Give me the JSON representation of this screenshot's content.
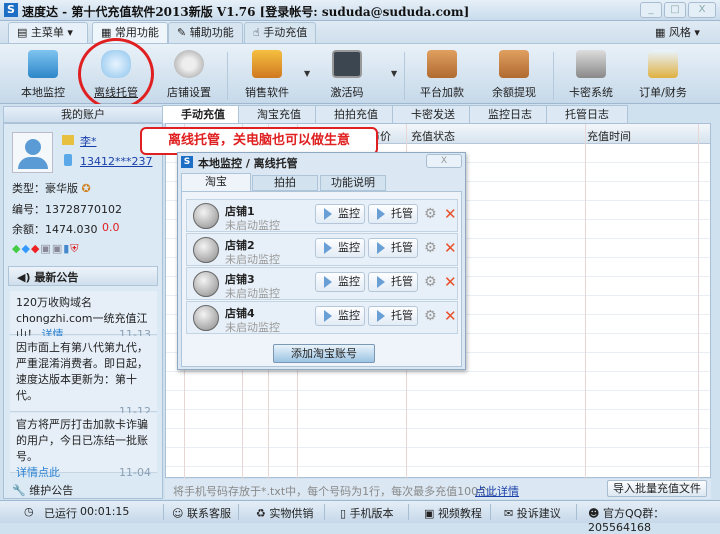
{
  "window": {
    "title": "速度达 - 第十代充值软件2013新版 V1.76  [登录帐号: sududa@sududa.com]",
    "min": "_",
    "max": "□",
    "close": "X"
  },
  "menu": {
    "main": "主菜单",
    "tabs": [
      "常用功能",
      "辅助功能",
      "手动充值"
    ],
    "style": "风格"
  },
  "toolbar": [
    "本地监控",
    "离线托管",
    "店铺设置",
    "销售软件",
    "激活码",
    "平台加款",
    "余额提现",
    "卡密系统",
    "订单/财务"
  ],
  "account": {
    "title": "我的账户",
    "name": "李*",
    "phone": "13412***237",
    "type_label": "类型：",
    "type": "豪华版",
    "id_label": "编号：",
    "id": "13728770102",
    "balance_label": "余额：",
    "balance": "1474.030",
    "balance2": "0.0"
  },
  "notices": {
    "title": "最新公告",
    "items": [
      {
        "text": "120万收购域名chongzhi.com一统充值江山！",
        "link": "详情",
        "date": "11-13"
      },
      {
        "text": "因市面上有第八代第九代，严重混淆消费者。即日起，速度达版本更新为：第十代。",
        "date": "11-12"
      },
      {
        "text": "官方将严厉打击加款卡诈骗的用户，今日已冻结一批账号。",
        "link": "详情点此",
        "date": "11-04"
      }
    ],
    "maint": "维护公告"
  },
  "content_tabs": [
    "手动充值",
    "淘宝充值",
    "拍拍充值",
    "卡密发送",
    "监控日志",
    "托管日志"
  ],
  "table": {
    "headers": [
      "市价",
      "充值状态",
      "充值时间"
    ]
  },
  "bottom": {
    "hint": "将手机号码存放于*.txt中，每个号码为1行，每次最多充值100个。",
    "link": "点此详情",
    "import": "导入批量充值文件"
  },
  "callout": "离线托管，关电脑也可以做生意",
  "dialog": {
    "title": "本地监控 / 离线托管",
    "close": "X",
    "tabs": [
      "淘宝",
      "拍拍",
      "功能说明"
    ],
    "shops": [
      {
        "name": "店铺1",
        "status": "未启动监控"
      },
      {
        "name": "店铺2",
        "status": "未启动监控"
      },
      {
        "name": "店铺3",
        "status": "未启动监控"
      },
      {
        "name": "店铺4",
        "status": "未启动监控"
      }
    ],
    "monitor": "监控",
    "host": "托管",
    "add": "添加淘宝账号"
  },
  "status": {
    "running_label": "已运行",
    "running": "00:01:15",
    "items": [
      "联系客服",
      "实物供销",
      "手机版本",
      "视频教程",
      "投诉建议"
    ],
    "qq": "官方QQ群：205564168"
  }
}
